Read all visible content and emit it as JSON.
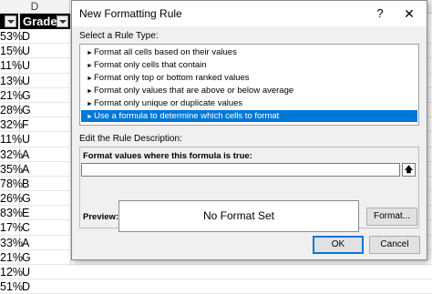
{
  "sheet": {
    "column_letter": "D",
    "header_label": "Grade",
    "rows": [
      {
        "pct": "53%",
        "grade": "D"
      },
      {
        "pct": "15%",
        "grade": "U"
      },
      {
        "pct": "11%",
        "grade": "U"
      },
      {
        "pct": "13%",
        "grade": "U"
      },
      {
        "pct": "21%",
        "grade": "G"
      },
      {
        "pct": "28%",
        "grade": "G"
      },
      {
        "pct": "32%",
        "grade": "F"
      },
      {
        "pct": "11%",
        "grade": "U"
      },
      {
        "pct": "32%",
        "grade": "A"
      },
      {
        "pct": "35%",
        "grade": "A"
      },
      {
        "pct": "78%",
        "grade": "B"
      },
      {
        "pct": "26%",
        "grade": "G"
      },
      {
        "pct": "83%",
        "grade": "E"
      },
      {
        "pct": "17%",
        "grade": "C"
      },
      {
        "pct": "33%",
        "grade": "A"
      },
      {
        "pct": "21%",
        "grade": "G"
      },
      {
        "pct": "12%",
        "grade": "U"
      },
      {
        "pct": "51%",
        "grade": "D"
      }
    ]
  },
  "dialog": {
    "title": "New Formatting Rule",
    "help_glyph": "?",
    "close_glyph": "✕",
    "select_rule_label": "Select a Rule Type:",
    "rule_types": [
      "Format all cells based on their values",
      "Format only cells that contain",
      "Format only top or bottom ranked values",
      "Format only values that are above or below average",
      "Format only unique or duplicate values",
      "Use a formula to determine which cells to format"
    ],
    "selected_index": 5,
    "edit_rule_label": "Edit the Rule Description:",
    "formula_label": "Format values where this formula is true:",
    "formula_value": "",
    "preview_label": "Preview:",
    "preview_text": "No Format Set",
    "format_button": "Format...",
    "ok_button": "OK",
    "cancel_button": "Cancel"
  },
  "colors": {
    "selection": "#0078d7",
    "dialog_bg": "#f0f0f0",
    "header_bg": "#000000"
  }
}
